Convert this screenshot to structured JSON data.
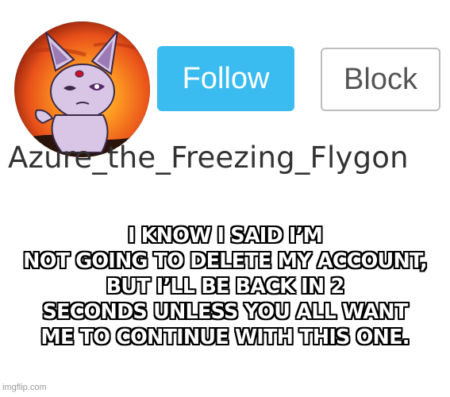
{
  "profile": {
    "username": "Azure_the_Freezing_Flygon",
    "follow_label": "Follow",
    "block_label": "Block"
  },
  "caption": {
    "lines": [
      "I KNOW I SAID I’M",
      "NOT GOING TO DELETE MY ACCOUNT,",
      "BUT I’LL BE BACK IN 2",
      "SECONDS UNLESS YOU ALL WANT",
      "ME TO CONTINUE WITH THIS ONE."
    ]
  },
  "watermark": "imgflip.com",
  "colors": {
    "follow_button": "#3bbcf0",
    "block_border": "#bdbdbd",
    "caption_text": "#ffffff",
    "caption_outline": "#000000",
    "avatar_sunset": "#e8501a",
    "avatar_character": "#d9c6e6"
  },
  "icons": {
    "avatar": "espeon-avatar-icon"
  }
}
